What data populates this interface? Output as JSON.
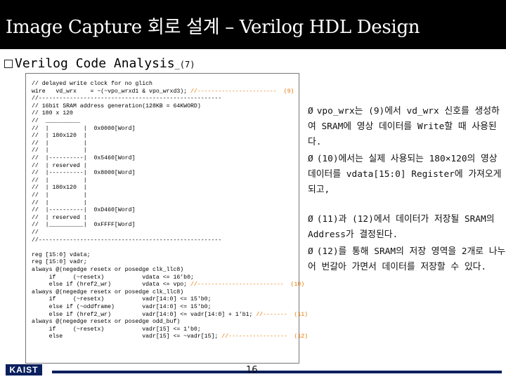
{
  "slide": {
    "title": "Image Capture 회로 설계 – Verilog HDL Design",
    "section_heading": "Verilog Code Analysis",
    "section_heading_suffix": "_(7)",
    "page_number": "16",
    "logo_text": "KAIST"
  },
  "code": [
    "// delayed write clock for no glich",
    "wire   vd_wrx    = ~(~vpo_wrxd1 & vpo_wrxd3); //-----------------------  (9)",
    "//-----------------------------------------------------",
    "// 16bit SRAM address generation(128KB = 64KWORD)",
    "// 180 x 120",
    "//  __________",
    "//  |          |  0x0000[Word]",
    "//  | 180x120  |",
    "//  |          |",
    "//  |          |",
    "//  |----------|  0x5460[Word]",
    "//  | reserved |",
    "//  |----------|  0x8000[Word]",
    "//  |          |",
    "//  | 180x120  |",
    "//  |          |",
    "//  |          |",
    "//  |----------|  0xD460[Word]",
    "//  | reserved |",
    "//  |__________|  0xFFFF[Word]",
    "//",
    "//-----------------------------------------------------",
    "",
    "reg [15:0] vdata;",
    "reg [15:0] vadr;",
    "always @(negedge resetx or posedge clk_llc8)",
    "     if     (~resetx)           vdata <= 16'b0;",
    "     else if (href2_wr)         vdata <= vpo; //-------------------------  (10)",
    "always @(negedge resetx or posedge clk_llc8)",
    "     if     (~resetx)           vadr[14:0] <= 15'b0;",
    "     else if (~oddframe)        vadr[14:0] <= 15'b0;",
    "     else if (href2_wr)         vadr[14:0] <= vadr[14:0] + 1'b1; //-------  (11)",
    "always @(negedge resetx or posedge odd_buf)",
    "     if     (~resetx)           vadr[15] <= 1'b0;",
    "     else                       vadr[15] <= ~vadr[15]; //-----------------  (12)"
  ],
  "code_highlight_markers": [
    "(9)",
    "(10)",
    "(11)",
    "(12)"
  ],
  "notes": [
    {
      "arrow": "Ø",
      "text": "vpo_wrx는 (9)에서 vd_wrx 신호를 생성하여 SRAM에 영상 데이터를 Write할 때 사용된다."
    },
    {
      "arrow": "Ø",
      "text": "(10)에서는 실제 사용되는 180×120의 영상 데이터를 vdata[15:0] Register에 가져오게 되고,"
    },
    {
      "arrow": "Ø",
      "text": "(11)과 (12)에서 데이터가 저장될 SRAM의 Address가 결정된다."
    },
    {
      "arrow": "Ø",
      "text": "(12)를 통해 SRAM의 저장 영역을 2개로 나누어 번갈아 가면서 데이터를 저장할 수 있다."
    }
  ],
  "colors": {
    "title_bg": "#000000",
    "title_text": "#ffffff",
    "marker": "#e87800",
    "footer_brand": "#0a1f5e"
  }
}
